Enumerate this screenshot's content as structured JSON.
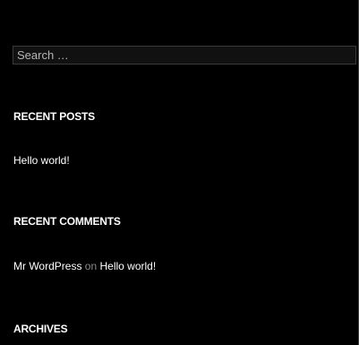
{
  "search": {
    "placeholder": "Search …"
  },
  "recent_posts": {
    "title": "RECENT POSTS",
    "items": [
      {
        "label": "Hello world!"
      }
    ]
  },
  "recent_comments": {
    "title": "RECENT COMMENTS",
    "items": [
      {
        "author": "Mr WordPress",
        "connector": "on",
        "post": "Hello world!"
      }
    ]
  },
  "archives": {
    "title": "ARCHIVES"
  }
}
